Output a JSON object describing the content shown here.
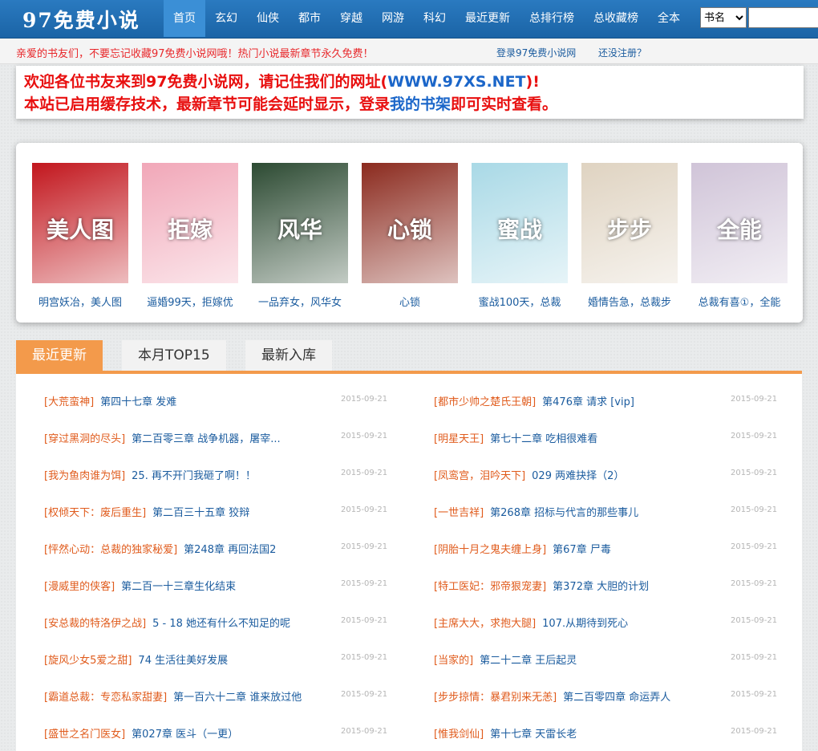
{
  "header": {
    "logo": "97免费小说",
    "nav": [
      "首页",
      "玄幻",
      "仙侠",
      "都市",
      "穿越",
      "网游",
      "科幻",
      "最近更新",
      "总排行榜",
      "总收藏榜",
      "全本"
    ],
    "active_nav": "首页",
    "search_select": "书名"
  },
  "notice": {
    "text": "亲爱的书友们，不要忘记收藏97免费小说网哦！热门小说最新章节永久免费！",
    "login": "登录97免费小说网",
    "register": "还没注册？"
  },
  "welcome": {
    "line1_a": "欢迎各位书友来到97免费小说网，请记住我们的网址(",
    "line1_url": "WWW.97XS.NET",
    "line1_b": ")!",
    "line2_a": "本站已启用缓存技术，最新章节可能会延时显示，登录",
    "line2_link": "我的书架",
    "line2_b": "即可实时查看。"
  },
  "colors": {
    "nav_bg": "#1b64a6",
    "accent_orange": "#f39a4b",
    "link_blue": "#1a5b9e",
    "category_orange": "#e05b1c",
    "alert_red": "#e80f0f"
  },
  "featured": [
    {
      "name": "明宫妖冶，美人图",
      "cover_text": "美人图",
      "bg": "#c2161d"
    },
    {
      "name": "逼婚99天，拒嫁优",
      "cover_text": "拒嫁",
      "bg": "#f1a7b8"
    },
    {
      "name": "一品弃女，风华女",
      "cover_text": "风华",
      "bg": "#2c4a32"
    },
    {
      "name": "心锁",
      "cover_text": "心锁",
      "bg": "#8b2a1e"
    },
    {
      "name": "蜜战100天，总裁",
      "cover_text": "蜜战",
      "bg": "#a9d9e6"
    },
    {
      "name": "婚情告急，总裁步",
      "cover_text": "步步",
      "bg": "#dfd3c1"
    },
    {
      "name": "总裁有喜①，全能",
      "cover_text": "全能",
      "bg": "#d0c4d8"
    }
  ],
  "tabs": [
    "最近更新",
    "本月TOP15",
    "最新入库"
  ],
  "updates_left": [
    {
      "cat": "[大荒蛮神]",
      "chap": "第四十七章 发难",
      "date": "2015-09-21"
    },
    {
      "cat": "[穿过黑洞的尽头]",
      "chap": "第二百零三章 战争机器，屠宰...",
      "date": "2015-09-21"
    },
    {
      "cat": "[我为鱼肉谁为饵]",
      "chap": "25. 再不开门我砸了啊！！",
      "date": "2015-09-21"
    },
    {
      "cat": "[权倾天下：废后重生]",
      "chap": "第二百三十五章 狡辩",
      "date": "2015-09-21"
    },
    {
      "cat": "[怦然心动：总裁的独家秘爱]",
      "chap": "第248章 再回法国2",
      "date": "2015-09-21"
    },
    {
      "cat": "[漫威里的侠客]",
      "chap": "第二百一十三章生化结束",
      "date": "2015-09-21"
    },
    {
      "cat": "[安总裁的特洛伊之战]",
      "chap": "5 - 18 她还有什么不知足的呢",
      "date": "2015-09-21"
    },
    {
      "cat": "[旋风少女5爱之甜]",
      "chap": "74 生活往美好发展",
      "date": "2015-09-21"
    },
    {
      "cat": "[霸道总裁：专恋私家甜妻]",
      "chap": "第一百六十二章 谁来放过他",
      "date": "2015-09-21"
    },
    {
      "cat": "[盛世之名门医女]",
      "chap": "第027章 医斗（一更）",
      "date": "2015-09-21"
    }
  ],
  "updates_right": [
    {
      "cat": "[都市少帅之楚氏王朝]",
      "chap": "第476章 请求 [vip]",
      "date": "2015-09-21"
    },
    {
      "cat": "[明星天王]",
      "chap": "第七十二章 吃相很难看",
      "date": "2015-09-21"
    },
    {
      "cat": "[凤鸾宫，泪吟天下]",
      "chap": "029 两难抉择（2）",
      "date": "2015-09-21"
    },
    {
      "cat": "[一世吉祥]",
      "chap": "第268章 招标与代言的那些事儿",
      "date": "2015-09-21"
    },
    {
      "cat": "[阴胎十月之鬼夫缠上身]",
      "chap": "第67章 尸毒",
      "date": "2015-09-21"
    },
    {
      "cat": "[特工医妃：邪帝狠宠妻]",
      "chap": "第372章 大胆的计划",
      "date": "2015-09-21"
    },
    {
      "cat": "[主席大大，求抱大腿]",
      "chap": "107.从期待到死心",
      "date": "2015-09-21"
    },
    {
      "cat": "[当家的]",
      "chap": "第二十二章 王后起灵",
      "date": "2015-09-21"
    },
    {
      "cat": "[步步掠情：暴君别来无恙]",
      "chap": "第二百零四章 命运弄人",
      "date": "2015-09-21"
    },
    {
      "cat": "[惟我剑仙]",
      "chap": "第十七章 天雷长老",
      "date": "2015-09-21"
    }
  ]
}
